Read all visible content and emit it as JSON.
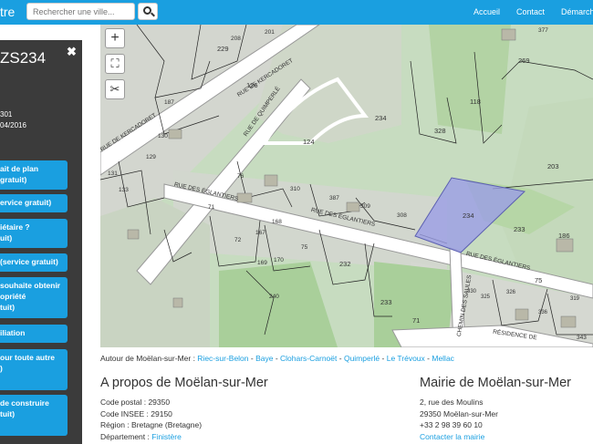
{
  "header": {
    "brand": "tre",
    "search_placeholder": "Rechercher une ville...",
    "nav": [
      "Accueil",
      "Contact",
      "Démarch"
    ]
  },
  "sidebar": {
    "title": "ZS234",
    "close": "✖",
    "info": [
      "301",
      "04/2016"
    ],
    "buttons": [
      [
        "ait de plan",
        "gratuit)"
      ],
      [
        "ervice gratuit)"
      ],
      [
        "iétaire ?",
        "uit)"
      ],
      [
        "(service gratuit)"
      ],
      [
        "souhaite obtenir",
        "opriété",
        "tuit)"
      ],
      [
        "iliation"
      ],
      [
        "our toute autre",
        ")"
      ],
      [
        "de construire",
        "tuit)"
      ]
    ]
  },
  "map": {
    "controls": [
      "+",
      "−",
      "⛶",
      "✂"
    ],
    "streets": [
      "RUE DE KERCADORET",
      "RUE DE QUIMPERLÉ",
      "RUE DE KERCADORET",
      "RUE DES ÉGLANTIERS",
      "RUE DES ÉGLANTIERS",
      "RUE DES ÉGLANTIERS",
      "CHEMIN DES SAULES",
      "RÉSIDENCE DE"
    ],
    "parcels": [
      "208",
      "201",
      "229",
      "126",
      "124",
      "234",
      "328",
      "118",
      "269",
      "203",
      "187",
      "130",
      "129",
      "133",
      "131",
      "76",
      "310",
      "387",
      "309",
      "308",
      "234",
      "233",
      "186",
      "71",
      "72",
      "167",
      "168",
      "75",
      "232",
      "169",
      "170",
      "240",
      "233",
      "71",
      "325",
      "326",
      "336",
      "75",
      "343",
      "377",
      "319",
      "330"
    ]
  },
  "nearby": {
    "prefix": "Autour de Moëlan-sur-Mer : ",
    "towns": [
      "Riec-sur-Belon",
      "Baye",
      "Clohars-Carnoët",
      "Quimperlé",
      "Le Trévoux",
      "Mellac"
    ],
    "separator": " - "
  },
  "about": {
    "title": "A propos de Moëlan-sur-Mer",
    "postal": "Code postal : 29350",
    "insee": "Code INSEE : 29150",
    "region": "Région : Bretagne (Bretagne)",
    "dept_label": "Département : ",
    "dept_value": "Finistère"
  },
  "mairie": {
    "title": "Mairie de Moëlan-sur-Mer",
    "address1": "2, rue des Moulins",
    "address2": "29350 Moëlan-sur-Mer",
    "phone": "+33 2 98 39 60 10",
    "contact": "Contacter la mairie"
  },
  "colors": {
    "accent": "#1a9fe0",
    "sidebar": "#3b3b3b",
    "map_green": "#bcd7b6",
    "parcel_highlight": "#9b9ee6"
  }
}
